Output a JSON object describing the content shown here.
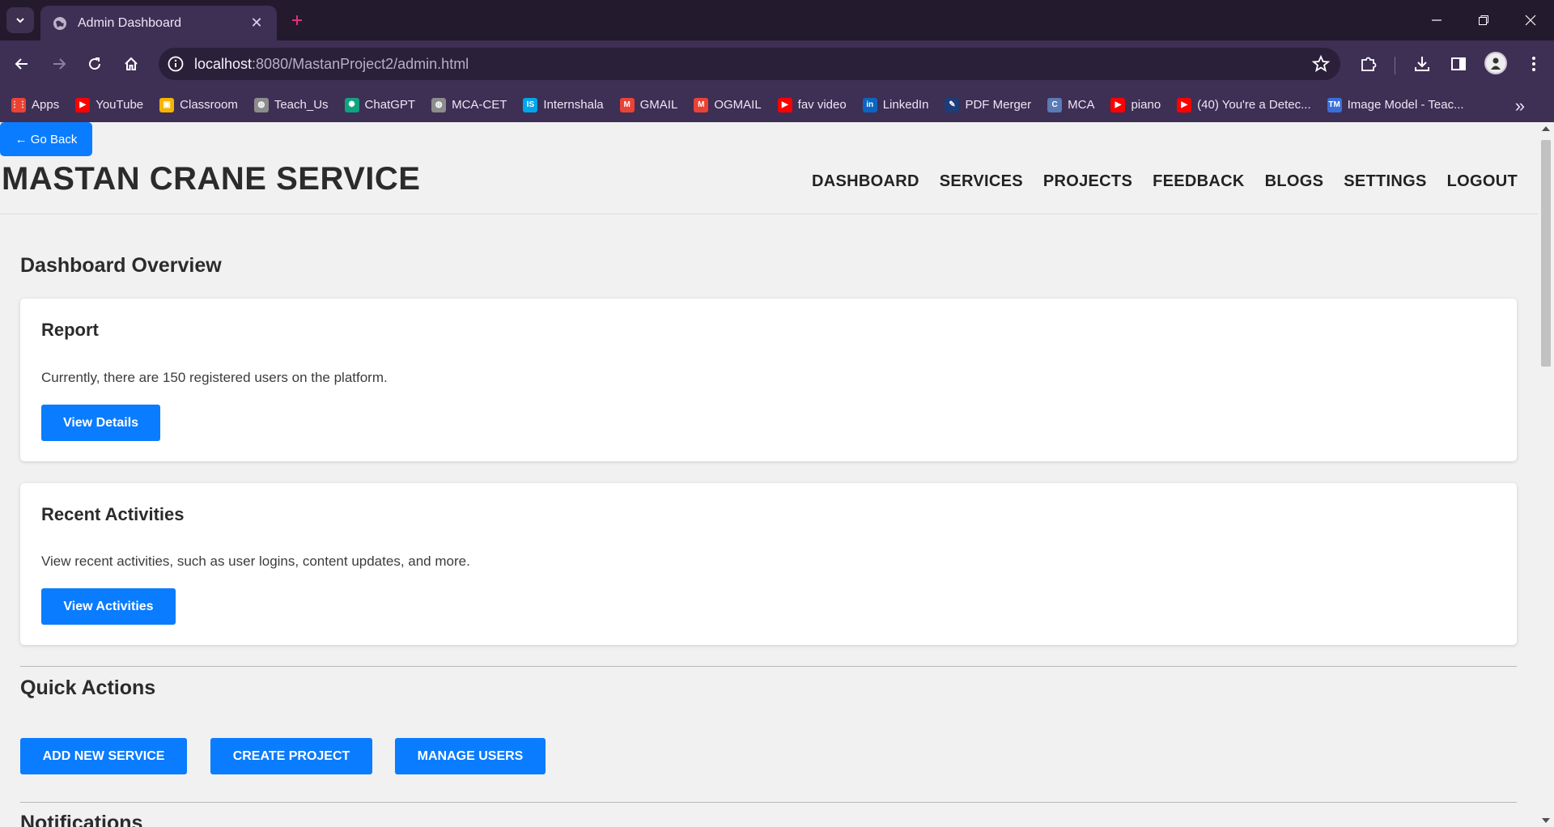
{
  "browser": {
    "tab_title": "Admin Dashboard",
    "url_host": "localhost",
    "url_rest": ":8080/MastanProject2/admin.html",
    "bookmarks": [
      {
        "label": "Apps",
        "icon": "apps-grid-icon",
        "color": "#ea4335"
      },
      {
        "label": "YouTube",
        "icon": "youtube-icon",
        "color": "#ff0000"
      },
      {
        "label": "Classroom",
        "icon": "classroom-icon",
        "color": "#f5b400"
      },
      {
        "label": "Teach_Us",
        "icon": "globe-icon",
        "color": "#8c8c8c"
      },
      {
        "label": "ChatGPT",
        "icon": "chatgpt-icon",
        "color": "#10a37f"
      },
      {
        "label": "MCA-CET",
        "icon": "globe-icon",
        "color": "#8c8c8c"
      },
      {
        "label": "Internshala",
        "icon": "internshala-icon",
        "color": "#00a5ec"
      },
      {
        "label": "GMAIL",
        "icon": "gmail-icon",
        "color": "#ea4335"
      },
      {
        "label": "OGMAIL",
        "icon": "gmail-icon",
        "color": "#ea4335"
      },
      {
        "label": "fav video",
        "icon": "youtube-icon",
        "color": "#ff0000"
      },
      {
        "label": "LinkedIn",
        "icon": "linkedin-icon",
        "color": "#0a66c2"
      },
      {
        "label": "PDF Merger",
        "icon": "pdf-merger-icon",
        "color": "#1d3c78"
      },
      {
        "label": "MCA",
        "icon": "cet-icon",
        "color": "#5a7bb5"
      },
      {
        "label": "piano",
        "icon": "youtube-icon",
        "color": "#ff0000"
      },
      {
        "label": "(40) You're a Detec...",
        "icon": "youtube-icon",
        "color": "#ff0000"
      },
      {
        "label": "Image Model - Teac...",
        "icon": "tm-icon",
        "color": "#3a6fd8"
      }
    ]
  },
  "page": {
    "go_back": "← Go Back",
    "brand": "MASTAN CRANE SERVICE",
    "nav": [
      "DASHBOARD",
      "SERVICES",
      "PROJECTS",
      "FEEDBACK",
      "BLOGS",
      "SETTINGS",
      "LOGOUT"
    ],
    "overview_title": "Dashboard Overview",
    "report": {
      "title": "Report",
      "text": "Currently, there are 150 registered users on the platform.",
      "button": "View Details"
    },
    "activities": {
      "title": "Recent Activities",
      "text": "View recent activities, such as user logins, content updates, and more.",
      "button": "View Activities"
    },
    "quick_actions_title": "Quick Actions",
    "quick_actions": [
      "ADD NEW SERVICE",
      "CREATE PROJECT",
      "MANAGE USERS"
    ],
    "notifications_title": "Notifications"
  },
  "colors": {
    "primary_button": "#0a7cff",
    "browser_frame": "#3e2f55",
    "tabstrip": "#231a2d"
  }
}
